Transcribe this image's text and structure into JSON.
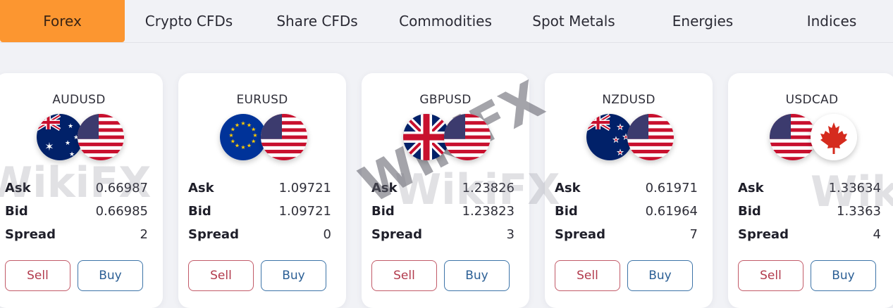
{
  "tabs": [
    {
      "label": "Forex",
      "active": true
    },
    {
      "label": "Crypto CFDs",
      "active": false
    },
    {
      "label": "Share CFDs",
      "active": false
    },
    {
      "label": "Commodities",
      "active": false
    },
    {
      "label": "Spot Metals",
      "active": false
    },
    {
      "label": "Energies",
      "active": false
    },
    {
      "label": "Indices",
      "active": false
    }
  ],
  "labels": {
    "ask": "Ask",
    "bid": "Bid",
    "spread": "Spread",
    "sell": "Sell",
    "buy": "Buy"
  },
  "cards": [
    {
      "pair": "AUDUSD",
      "base_flag": "australia-flag-icon",
      "quote_flag": "usa-flag-icon",
      "ask": "0.66987",
      "bid": "0.66985",
      "spread": "2"
    },
    {
      "pair": "EURUSD",
      "base_flag": "eu-flag-icon",
      "quote_flag": "usa-flag-icon",
      "ask": "1.09721",
      "bid": "1.09721",
      "spread": "0"
    },
    {
      "pair": "GBPUSD",
      "base_flag": "uk-flag-icon",
      "quote_flag": "usa-flag-icon",
      "ask": "1.23826",
      "bid": "1.23823",
      "spread": "3"
    },
    {
      "pair": "NZDUSD",
      "base_flag": "new-zealand-flag-icon",
      "quote_flag": "usa-flag-icon",
      "ask": "0.61971",
      "bid": "0.61964",
      "spread": "7"
    },
    {
      "pair": "USDCAD",
      "base_flag": "usa-flag-icon",
      "quote_flag": "canada-flag-icon",
      "ask": "1.33634",
      "bid": "1.3363",
      "spread": "4"
    }
  ],
  "watermark": {
    "text": "WikiFX"
  },
  "colors": {
    "accent": "#fc9630",
    "sell": "#b23a4c",
    "buy": "#2b5f95"
  }
}
